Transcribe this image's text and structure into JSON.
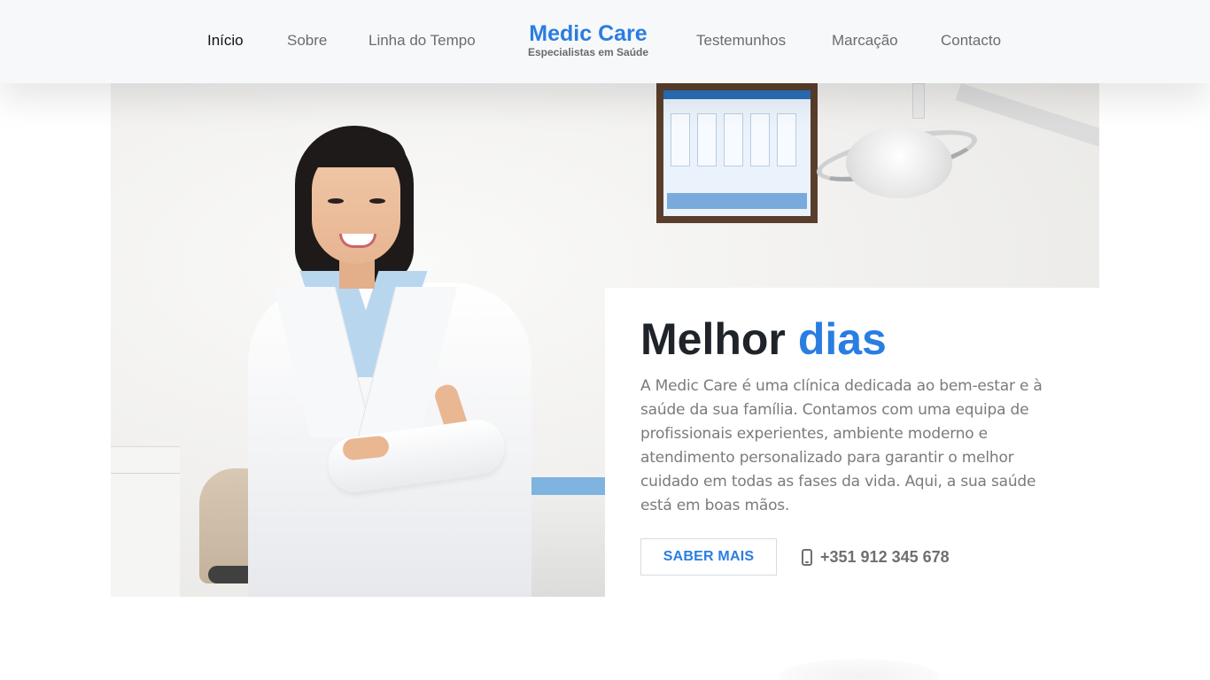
{
  "nav": {
    "items": [
      {
        "label": "Início",
        "active": true
      },
      {
        "label": "Sobre",
        "active": false
      },
      {
        "label": "Linha do Tempo",
        "active": false
      },
      {
        "label": "Testemunhos",
        "active": false
      },
      {
        "label": "Marcação",
        "active": false
      },
      {
        "label": "Contacto",
        "active": false
      }
    ],
    "brand": {
      "title": "Medic Care",
      "subtitle": "Especialistas em Saúde"
    }
  },
  "hero": {
    "title_main": "Melhor",
    "title_accent": "dias",
    "description": "A Medic Care é uma clínica dedicada ao bem-estar e à saúde da sua família. Contamos com uma equipa de profissionais experientes, ambiente moderno e atendimento personalizado para garantir o melhor cuidado em todas as fases da vida. Aqui, a sua saúde está em boas mãos.",
    "button_label": "SABER MAIS",
    "phone": "+351 912 345 678",
    "phone_icon": "mobile-phone-icon"
  },
  "colors": {
    "accent": "#2a7de1",
    "heading": "#1f232a",
    "text_muted": "#7b7b7b",
    "navbar_bg": "#f7f8fa"
  }
}
